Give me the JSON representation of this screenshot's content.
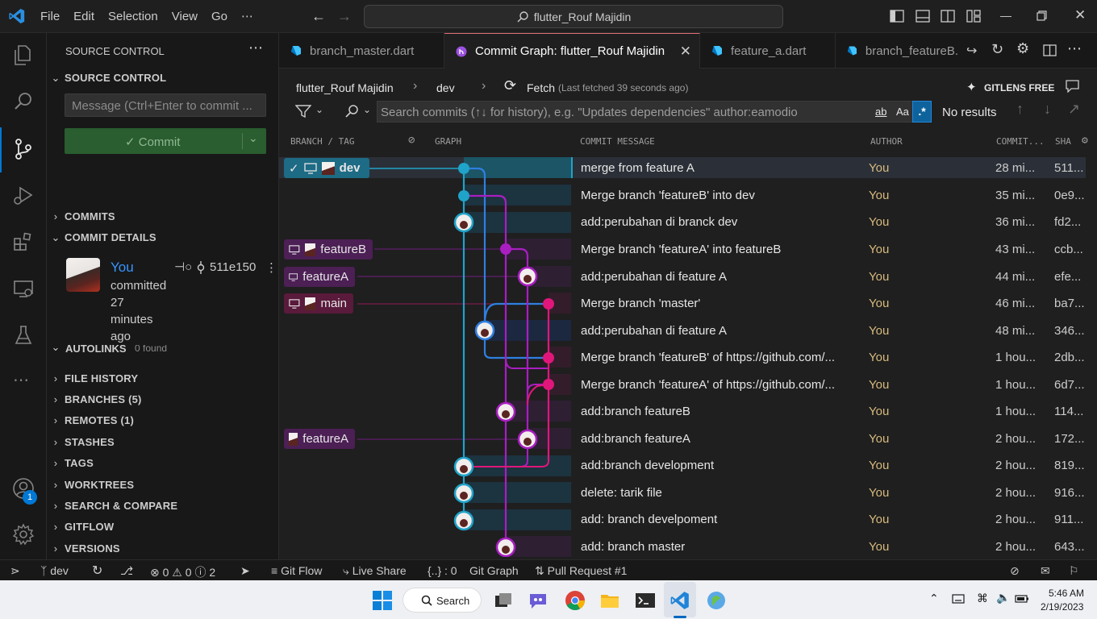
{
  "titlebar": {
    "menus": [
      "File",
      "Edit",
      "Selection",
      "View",
      "Go",
      "⋯"
    ],
    "search_text": "flutter_Rouf Majidin"
  },
  "sidebar": {
    "title": "SOURCE CONTROL",
    "section_source_control": "SOURCE CONTROL",
    "message_placeholder": "Message (Ctrl+Enter to commit ...",
    "commit_button": "✓ Commit",
    "commits": "COMMITS",
    "commit_details": "COMMIT DETAILS",
    "author": "You",
    "committed": "committed",
    "time_lines": [
      "27",
      "minutes",
      "ago"
    ],
    "sha": "511e150",
    "autolinks": "AUTOLINKS",
    "autolinks_found": "0 found",
    "sections": [
      "FILE HISTORY",
      "BRANCHES (5)",
      "REMOTES (1)",
      "STASHES",
      "TAGS",
      "WORKTREES",
      "SEARCH & COMPARE",
      "GITFLOW",
      "VERSIONS"
    ]
  },
  "tabs": [
    {
      "label": "branch_master.dart",
      "active": false
    },
    {
      "label": "Commit Graph: flutter_Rouf Majidin",
      "active": true
    },
    {
      "label": "feature_a.dart",
      "active": false
    },
    {
      "label": "branch_featureB.",
      "active": false
    }
  ],
  "graph": {
    "repo": "flutter_Rouf Majidin",
    "branch": "dev",
    "fetch": "Fetch",
    "fetch_note": "(Last fetched 39 seconds ago)",
    "gitlens": "GITLENS FREE",
    "search_placeholder": "Search commits (↑↓ for history), e.g. \"Updates dependencies\" author:eamodio",
    "search_ab": "ab",
    "search_aa": "Aa",
    "search_regex": ".*",
    "no_results": "No results",
    "columns": {
      "branch": "BRANCH / TAG",
      "graph": "GRAPH",
      "message": "COMMIT MESSAGE",
      "author": "AUTHOR",
      "date": "COMMIT...",
      "sha": "SHA"
    }
  },
  "commits": [
    {
      "ref": "dev",
      "message": "merge from feature A",
      "author": "You",
      "date": "28 mi...",
      "sha": "511..."
    },
    {
      "ref": "",
      "message": "Merge branch 'featureB' into dev",
      "author": "You",
      "date": "35 mi...",
      "sha": "0e9..."
    },
    {
      "ref": "",
      "message": "add:perubahan di branck dev",
      "author": "You",
      "date": "36 mi...",
      "sha": "fd2..."
    },
    {
      "ref": "featureB",
      "message": "Merge branch 'featureA' into featureB",
      "author": "You",
      "date": "43 mi...",
      "sha": "ccb..."
    },
    {
      "ref": "featureA",
      "message": "add:perubahan di feature A",
      "author": "You",
      "date": "44 mi...",
      "sha": "efe..."
    },
    {
      "ref": "main",
      "message": "Merge branch 'master'",
      "author": "You",
      "date": "46 mi...",
      "sha": "ba7..."
    },
    {
      "ref": "",
      "message": "add:perubahan di feature A",
      "author": "You",
      "date": "48 mi...",
      "sha": "346..."
    },
    {
      "ref": "",
      "message": "Merge branch 'featureB' of https://github.com/...",
      "author": "You",
      "date": "1 hou...",
      "sha": "2db..."
    },
    {
      "ref": "",
      "message": "Merge branch 'featureA' of https://github.com/...",
      "author": "You",
      "date": "1 hou...",
      "sha": "6d7..."
    },
    {
      "ref": "",
      "message": "add:branch featureB",
      "author": "You",
      "date": "1 hou...",
      "sha": "114..."
    },
    {
      "ref": "featureA",
      "message": "add:branch featureA",
      "author": "You",
      "date": "2 hou...",
      "sha": "172..."
    },
    {
      "ref": "",
      "message": "add:branch development",
      "author": "You",
      "date": "2 hou...",
      "sha": "819..."
    },
    {
      "ref": "",
      "message": "delete: tarik file",
      "author": "You",
      "date": "2 hou...",
      "sha": "916..."
    },
    {
      "ref": "",
      "message": "add: branch develpoment",
      "author": "You",
      "date": "2 hou...",
      "sha": "911..."
    },
    {
      "ref": "",
      "message": "add: branch master",
      "author": "You",
      "date": "2 hou...",
      "sha": "643..."
    }
  ],
  "statusbar": {
    "branch": "dev",
    "errors": "0",
    "warnings": "0",
    "infos": "2",
    "gitflow": "Git Flow",
    "liveshare": "Live Share",
    "braces": "{..} : 0",
    "gitgraph": "Git Graph",
    "pullrequest": "Pull Request #1"
  },
  "taskbar": {
    "search": "Search",
    "time": "5:46 AM",
    "date": "2/19/2023"
  },
  "accounts_badge": "1",
  "colors": {
    "accent_blue": "#0078d4",
    "lane_cyan": "#1fa3c8",
    "lane_blue": "#2f7fe0",
    "lane_purple": "#a91ec1",
    "lane_magenta": "#e0167a",
    "commit_green": "#2a5d2f"
  }
}
